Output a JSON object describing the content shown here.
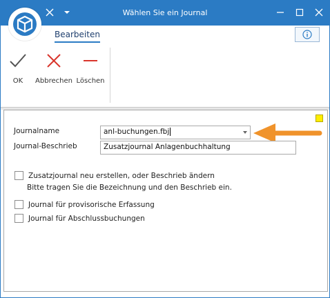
{
  "window": {
    "title": "Wählen Sie ein Journal",
    "accent_color": "#2b7bc4",
    "icons": {
      "app": "cube-icon",
      "quick_close": "x-icon",
      "quick_menu": "dropdown-icon",
      "minimize": "minimize-icon",
      "maximize": "maximize-icon",
      "close": "close-icon"
    }
  },
  "ribbon": {
    "tab_label": "Bearbeiten",
    "info_icon": "info-icon",
    "buttons": [
      {
        "label": "OK",
        "icon": "checkmark-icon",
        "color": "#555555"
      },
      {
        "label": "Abbrechen",
        "icon": "cross-icon",
        "color": "#d9342b"
      },
      {
        "label": "Löschen",
        "icon": "minus-icon",
        "color": "#d9342b"
      }
    ]
  },
  "form": {
    "journalname_label": "Journalname",
    "journalname_value": "anl-buchungen.fbj",
    "beschrieb_label": "Journal-Beschrieb",
    "beschrieb_value": "Zusatzjournal Anlagenbuchhaltung",
    "checkboxes": [
      {
        "label": "Zusatzjournal neu erstellen, oder Beschrieb ändern",
        "checked": false
      },
      {
        "label": "Journal für provisorische Erfassung",
        "checked": false
      },
      {
        "label": "Journal für Abschlussbuchungen",
        "checked": false
      }
    ],
    "hint": "Bitte tragen Sie die Bezeichnung und den Beschrieb ein.",
    "annotation_color": "#f0932b",
    "marker_color": "#ffee00"
  }
}
